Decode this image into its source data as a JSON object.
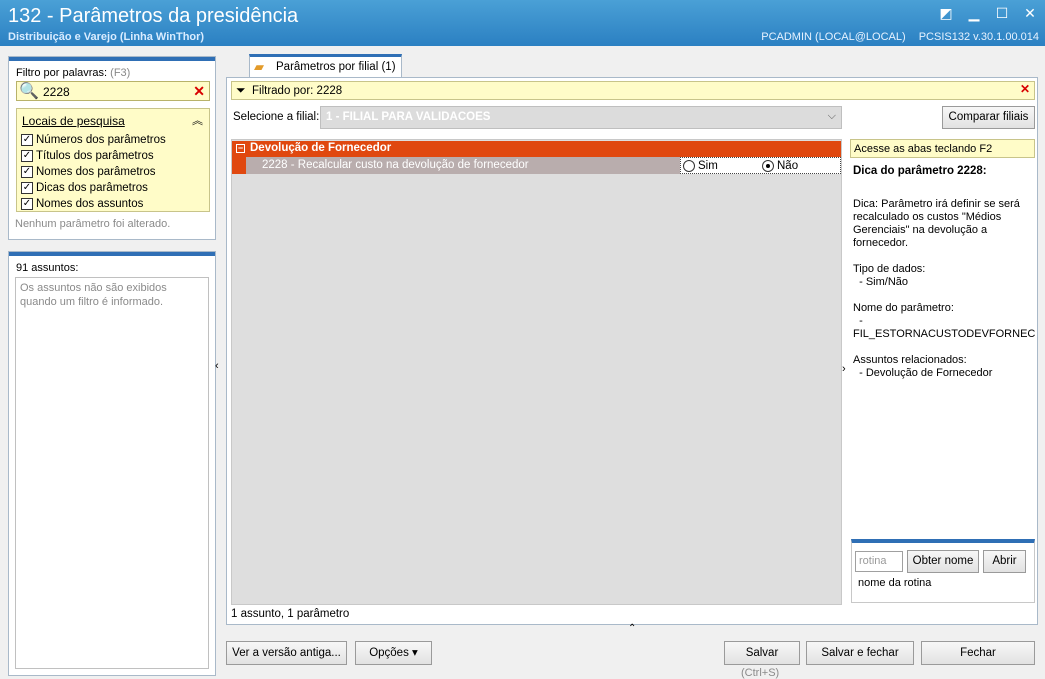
{
  "window": {
    "title": "132 - Parâmetros da presidência",
    "subtitle": "Distribuição e Varejo (Linha WinThor)",
    "user": "PCADMIN (LOCAL@LOCAL)",
    "version": "PCSIS132  v.30.1.00.014"
  },
  "filter": {
    "label": "Filtro por palavras:",
    "shortcut": "(F3)",
    "value": "2228",
    "locations_header": "Locais de pesquisa",
    "locations": [
      {
        "label": "Números dos parâmetros",
        "checked": true
      },
      {
        "label": "Títulos dos parâmetros",
        "checked": true
      },
      {
        "label": "Nomes dos parâmetros",
        "checked": true
      },
      {
        "label": "Dicas dos parâmetros",
        "checked": true
      },
      {
        "label": "Nomes dos assuntos",
        "checked": true
      }
    ],
    "status": "Nenhum parâmetro foi alterado."
  },
  "subjects": {
    "count_label": "91 assuntos:",
    "note": "Os assuntos não são exibidos quando um filtro é informado."
  },
  "tab": {
    "label": "Parâmetros por filial",
    "count": "(1)"
  },
  "filtered": {
    "label": "Filtrado por: 2228"
  },
  "branch": {
    "label": "Selecione a filial:",
    "value": "1 - FILIAL PARA VALIDACOES",
    "compare_button": "Comparar filiais"
  },
  "grid": {
    "group": "Devolução de Fornecedor",
    "row_label": "2228 - Recalcular custo na devolução de fornecedor",
    "options": [
      {
        "label": "Sim",
        "selected": false
      },
      {
        "label": "Não",
        "selected": true
      }
    ],
    "status": "1 assunto, 1 parâmetro"
  },
  "tip": {
    "access": "Acesse as abas teclando F2",
    "title": "Dica do parâmetro 2228:",
    "description": "Dica: Parâmetro irá definir se será recalculado os custos \"Médios Gerenciais\" na devolução a fornecedor.",
    "data_type_label": "Tipo de dados:",
    "data_type_value": "- Sim/Não",
    "param_name_label": "Nome do parâmetro:",
    "param_name_value": "- FIL_ESTORNACUSTODEVFORNEC",
    "related_label": "Assuntos relacionados:",
    "related_value": "- Devolução de Fornecedor"
  },
  "routine": {
    "placeholder": "rotina",
    "get_name": "Obter nome",
    "open": "Abrir",
    "name_label": "nome da rotina"
  },
  "footer": {
    "old_version": "Ver a versão antiga...",
    "options": "Opções",
    "save": "Salvar",
    "save_shortcut": "(Ctrl+S)",
    "save_close": "Salvar e fechar",
    "close": "Fechar"
  }
}
